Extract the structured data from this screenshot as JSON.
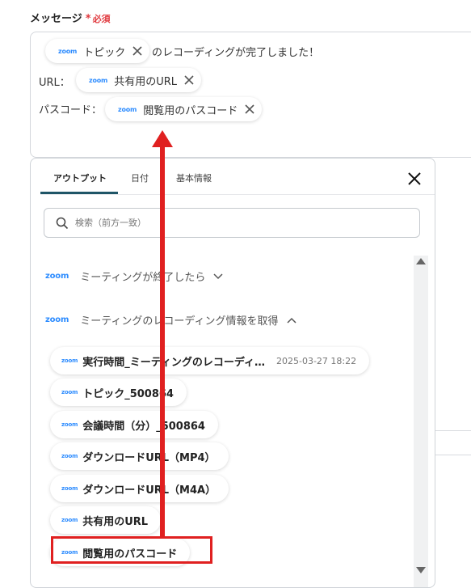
{
  "field": {
    "label": "メッセージ",
    "required_mark": "*",
    "required_text": "必須"
  },
  "message": {
    "line1_token": "トピック",
    "line1_suffix": "のレコーディングが完了しました！",
    "line2_label": "URL：",
    "line2_token": "共有用のURL",
    "line3_label": "パスコード：",
    "line3_token": "閲覧用のパスコード",
    "zoom_logo": "zoom"
  },
  "panel": {
    "tabs": [
      "アウトプット",
      "日付",
      "基本情報"
    ],
    "active_tab": "アウトプット",
    "search_placeholder": "検索（前方一致）",
    "sections": [
      {
        "logo": "zoom",
        "label": "ミーティングが終了したら",
        "state": "collapsed"
      },
      {
        "logo": "zoom",
        "label": "ミーティングのレコーディング情報を取得",
        "state": "expanded"
      }
    ],
    "outputs": [
      {
        "logo": "zoom",
        "label": "実行時間_ミーティングのレコーディ…",
        "value": "2025-03-27 18:22"
      },
      {
        "logo": "zoom",
        "label": "トピック_500864"
      },
      {
        "logo": "zoom",
        "label": "会議時間（分）_500864"
      },
      {
        "logo": "zoom",
        "label": "ダウンロードURL（MP4）"
      },
      {
        "logo": "zoom",
        "label": "ダウンロードURL（M4A）"
      },
      {
        "logo": "zoom",
        "label": "共有用のURL"
      },
      {
        "logo": "zoom",
        "label": "閲覧用のパスコード"
      }
    ]
  },
  "colors": {
    "accent": "#1f5567",
    "zoom": "#2d8cff",
    "required": "#e0393e",
    "annotation": "#e02020"
  }
}
